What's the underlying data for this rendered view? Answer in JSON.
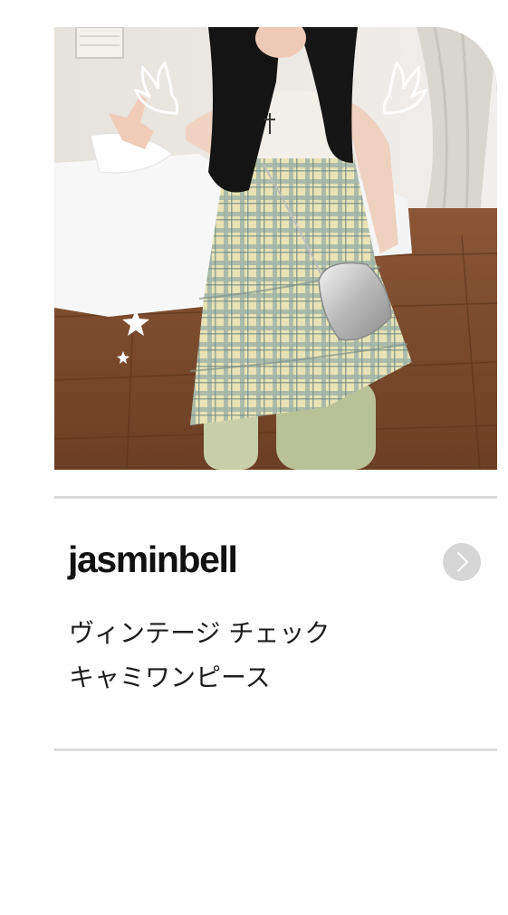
{
  "product": {
    "image_alt": "Model wearing a plaid tiered camisole dress with white angel-wing and star doodles",
    "brand": "jasminbell",
    "title_lines": [
      "ヴィンテージ チェック",
      "キャミワンピース"
    ]
  },
  "icons": {
    "next": "chevron-right-icon"
  },
  "colors": {
    "divider": "#dcdcdc",
    "arrow_button_bg": "#d6d6d6",
    "brand_text": "#111111",
    "title_text": "#1c1c1c"
  }
}
